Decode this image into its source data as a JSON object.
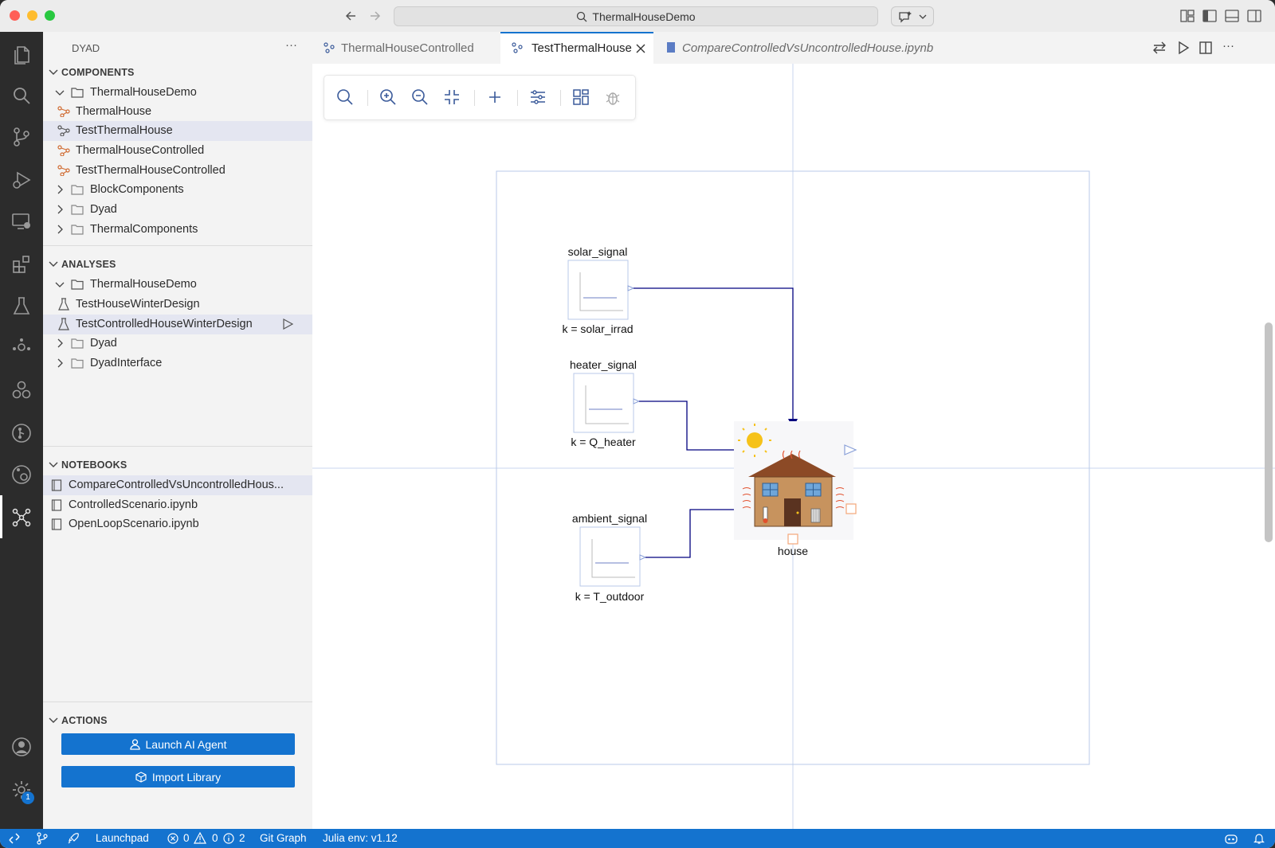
{
  "window": {
    "search_text": "ThermalHouseDemo"
  },
  "sidebar": {
    "title": "DYAD",
    "more": "···",
    "components": {
      "header": "COMPONENTS",
      "items": [
        {
          "label": "ThermalHouseDemo",
          "type": "folder-open"
        },
        {
          "label": "ThermalHouse",
          "type": "component"
        },
        {
          "label": "TestThermalHouse",
          "type": "component"
        },
        {
          "label": "ThermalHouseControlled",
          "type": "component"
        },
        {
          "label": "TestThermalHouseControlled",
          "type": "component"
        },
        {
          "label": "BlockComponents",
          "type": "folder"
        },
        {
          "label": "Dyad",
          "type": "folder"
        },
        {
          "label": "ThermalComponents",
          "type": "folder"
        }
      ]
    },
    "analyses": {
      "header": "ANALYSES",
      "items": [
        {
          "label": "ThermalHouseDemo",
          "type": "folder-open"
        },
        {
          "label": "TestHouseWinterDesign",
          "type": "analysis"
        },
        {
          "label": "TestControlledHouseWinterDesign",
          "type": "analysis"
        },
        {
          "label": "Dyad",
          "type": "folder"
        },
        {
          "label": "DyadInterface",
          "type": "folder"
        }
      ]
    },
    "notebooks": {
      "header": "NOTEBOOKS",
      "items": [
        {
          "label": "CompareControlledVsUncontrolledHous..."
        },
        {
          "label": "ControlledScenario.ipynb"
        },
        {
          "label": "OpenLoopScenario.ipynb"
        }
      ]
    },
    "actions": {
      "header": "ACTIONS",
      "launch_agent": "Launch AI Agent",
      "import_library": "Import Library"
    }
  },
  "tabs": [
    {
      "label": "ThermalHouseControlled",
      "active": false
    },
    {
      "label": "TestThermalHouse",
      "active": true
    },
    {
      "label": "CompareControlledVsUncontrolledHouse.ipynb",
      "active": false
    }
  ],
  "diagram": {
    "blocks": {
      "solar": {
        "name": "solar_signal",
        "param": "k = solar_irrad"
      },
      "heater": {
        "name": "heater_signal",
        "param": "k = Q_heater"
      },
      "ambient": {
        "name": "ambient_signal",
        "param": "k = T_outdoor"
      },
      "house": {
        "name": "house"
      }
    },
    "colors": {
      "wire": "#00007f",
      "port": "#3a5a9a",
      "frame": "#b8c9e8"
    }
  },
  "activity_badge": "1",
  "statusbar": {
    "launchpad": "Launchpad",
    "errors": "0",
    "warnings": "0",
    "info": "2",
    "git_graph": "Git Graph",
    "julia_env": "Julia env: v1.12"
  }
}
